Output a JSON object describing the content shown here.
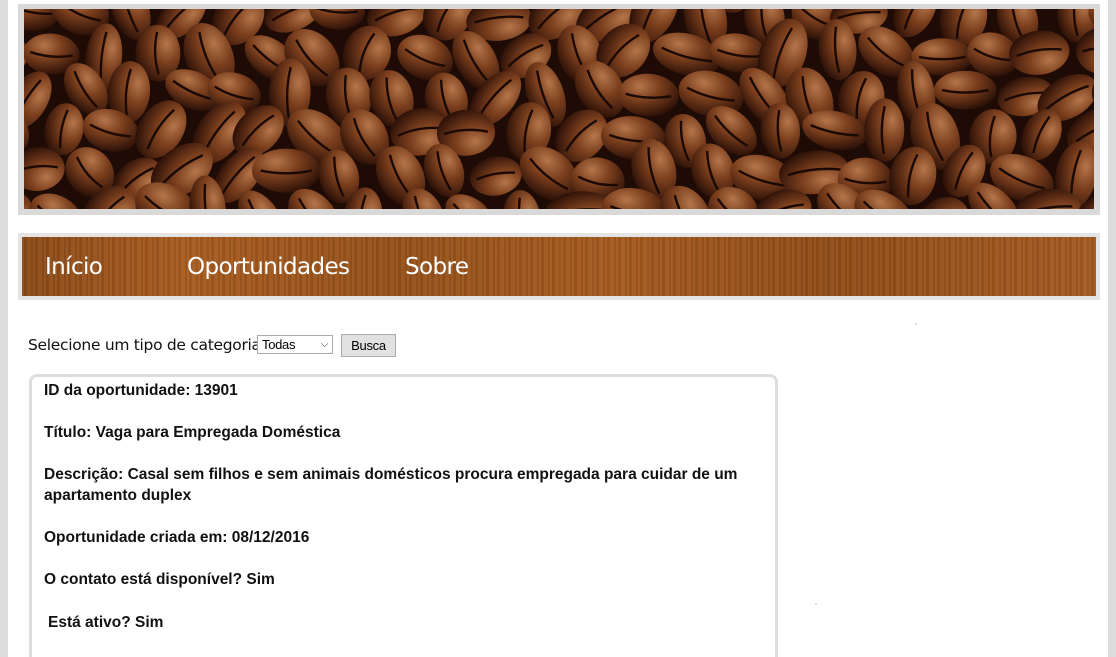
{
  "header": {
    "banner_image": "coffee-beans-banner"
  },
  "nav": {
    "items": [
      {
        "label": "Início"
      },
      {
        "label": "Oportunidades"
      },
      {
        "label": "Sobre"
      }
    ]
  },
  "filter": {
    "label": "Selecione um tipo de categoria:",
    "selected": "Todas",
    "button_label": "Busca"
  },
  "opportunity": {
    "id": "ID da oportunidade: 13901",
    "title": "Título: Vaga para Empregada Doméstica",
    "description": "Descrição: Casal sem filhos e sem animais domésticos procura empregada para cuidar de um apartamento duplex",
    "created": "Oportunidade criada em: 08/12/2016",
    "contact_available": "O contato está disponível? Sim",
    "active": "Está ativo? Sim"
  },
  "colors": {
    "nav_wood": "#9a531c",
    "frame_gray": "#d9d9d9",
    "card_border": "#dddddd"
  }
}
